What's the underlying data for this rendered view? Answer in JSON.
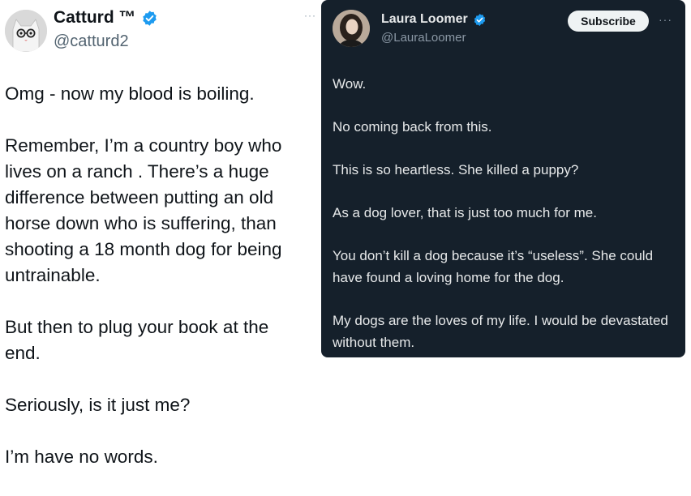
{
  "left_tweet": {
    "display_name": "Catturd ™",
    "handle": "@catturd2",
    "more_label": "···",
    "paragraphs": [
      "Omg - now my blood is boiling.",
      "Remember, I’m a country boy who lives on a ranch . There’s a huge difference between putting an old horse down who is suffering, than shooting a 18 month dog for being untrainable.",
      "But then to plug your book at the end.",
      "Seriously, is it just me?",
      "I’m have no words."
    ]
  },
  "right_tweet": {
    "display_name": "Laura Loomer",
    "handle": "@LauraLoomer",
    "subscribe_label": "Subscribe",
    "more_label": "···",
    "paragraphs": [
      "Wow.",
      "No coming back from this.",
      "This is so heartless. She killed a puppy?",
      "As a dog lover, that is just too much for me.",
      "You don’t kill a dog because it’s “useless”. She could have found a loving home for the dog.",
      "My dogs are the loves of my life. I would be devastated without them."
    ]
  },
  "colors": {
    "verified_blue": "#1d9bf0",
    "dark_background": "#15202b",
    "light_text": "#0f1419"
  },
  "icons": {
    "verified": "verified-badge-icon"
  }
}
